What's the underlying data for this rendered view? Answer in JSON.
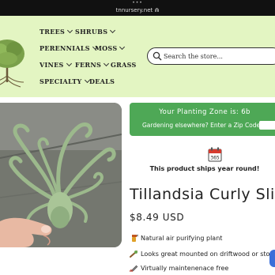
{
  "browser": {
    "dots": "•••",
    "url": "tnnursery.net ⋒"
  },
  "nav": {
    "trees": "TREES",
    "shrubs": "SHRUBS",
    "perennials": "PERENNIALS",
    "moss": "MOSS",
    "vines": "VINES",
    "ferns": "FERNS",
    "grass": "GRASS",
    "specialty": "SPECIALTY",
    "deals": "DEALS"
  },
  "search": {
    "placeholder": "Search the store..."
  },
  "zone": {
    "title": "Your Planting Zone is: 6b",
    "subtitle": "Gardening elsewhere? Enter a Zip Code:"
  },
  "shipping": {
    "calendar_number": "365",
    "text": "This product ships year round!"
  },
  "product": {
    "title": "Tillandsia Curly Slim",
    "price": "$8.49 USD"
  },
  "features": [
    {
      "icon": "spray-bottle-icon",
      "text": "Natural air purifying plant"
    },
    {
      "icon": "driftwood-icon",
      "text": "Looks great mounted on driftwood or stones"
    },
    {
      "icon": "pruning-shears-icon",
      "text": "Virtually maintenenace free"
    }
  ],
  "colors": {
    "header_bg": "#e3f5c2",
    "zone_bg": "#4ea856",
    "chat_accent": "#3b6fd9"
  }
}
